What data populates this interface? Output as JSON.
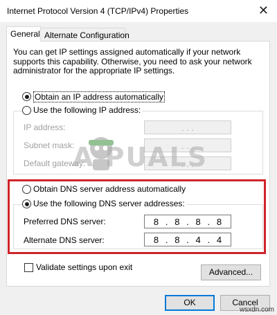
{
  "window": {
    "title": "Internet Protocol Version 4 (TCP/IPv4) Properties",
    "close_glyph": "✕"
  },
  "tabs": [
    {
      "label": "General",
      "active": true
    },
    {
      "label": "Alternate Configuration",
      "active": false
    }
  ],
  "description": "You can get IP settings assigned automatically if your network supports this capability. Otherwise, you need to ask your network administrator for the appropriate IP settings.",
  "ip_section": {
    "auto_option": {
      "label": "Obtain an IP address automatically",
      "selected": true
    },
    "manual_option": {
      "label": "Use the following IP address:",
      "selected": false
    },
    "fields": [
      {
        "label": "IP address:",
        "value": ". . .",
        "enabled": false
      },
      {
        "label": "Subnet mask:",
        "value": ". . .",
        "enabled": false
      },
      {
        "label": "Default gateway:",
        "value": ". . .",
        "enabled": false
      }
    ]
  },
  "dns_section": {
    "auto_option": {
      "label": "Obtain DNS server address automatically",
      "selected": false
    },
    "manual_option": {
      "label": "Use the following DNS server addresses:",
      "selected": true
    },
    "fields": [
      {
        "label": "Preferred DNS server:",
        "octets": [
          "8",
          "8",
          "8",
          "8"
        ]
      },
      {
        "label": "Alternate DNS server:",
        "octets": [
          "8",
          "8",
          "4",
          "4"
        ]
      }
    ],
    "highlight_color": "#d0232a"
  },
  "validate": {
    "label": "Validate settings upon exit",
    "checked": false
  },
  "buttons": {
    "advanced": "Advanced...",
    "ok": "OK",
    "cancel": "Cancel"
  },
  "watermark": {
    "text": "A  PUALS",
    "site": "wsxdn.com"
  },
  "colors": {
    "dialog_bg": "#f0f0f0",
    "panel_bg": "#ffffff",
    "focus_blue": "#0078d7"
  }
}
